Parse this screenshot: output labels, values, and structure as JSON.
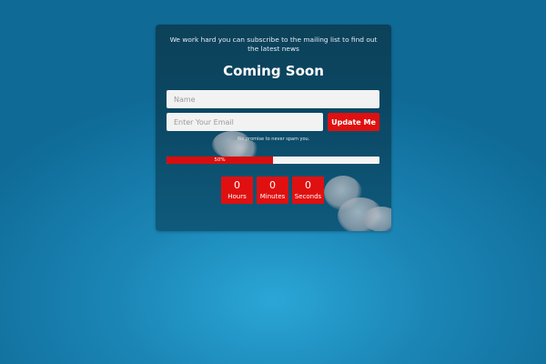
{
  "intro_text": "We work hard you can subscribe to the mailing list to find out the latest news",
  "title": "Coming Soon",
  "form": {
    "name_placeholder": "Name",
    "email_placeholder": "Enter Your Email",
    "submit_label": "Update Me",
    "promise_text": "We promise to never spam you."
  },
  "progress": {
    "value": 0.5,
    "label": "50%"
  },
  "countdown": [
    {
      "value": "0",
      "label": "Hours"
    },
    {
      "value": "0",
      "label": "Minutes"
    },
    {
      "value": "0",
      "label": "Seconds"
    }
  ],
  "colors": {
    "accent": "#e01010",
    "panel": "#0b4763",
    "background": "#1b86b6"
  }
}
